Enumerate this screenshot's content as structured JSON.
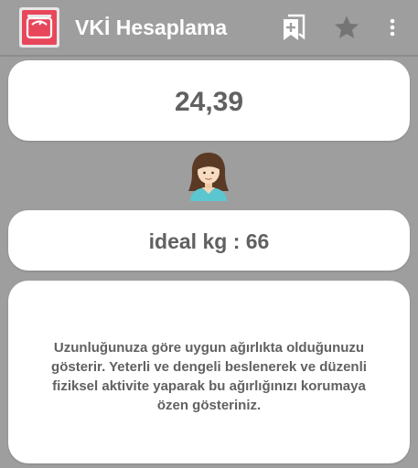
{
  "app_bar": {
    "title": "VKİ Hesaplama",
    "icons": {
      "app": "bathroom-scale-icon",
      "bookmark": "bookmark-add-icon",
      "favorite": "star-icon",
      "menu": "more-vert-icon"
    }
  },
  "result": {
    "bmi_value": "24,39",
    "avatar_icon": "woman-avatar-icon",
    "ideal_weight": "ideal kg : 66",
    "description": "Uzunluğunuza göre uygun ağırlıkta olduğunuzu gösterir. Yeterli ve dengeli beslenerek ve düzenli fiziksel aktivite yaparak bu ağırlığınızı korumaya özen gösteriniz."
  },
  "colors": {
    "background": "#9e9e9e",
    "card": "#ffffff",
    "text": "#616161",
    "app_icon_accent": "#e8475b"
  }
}
